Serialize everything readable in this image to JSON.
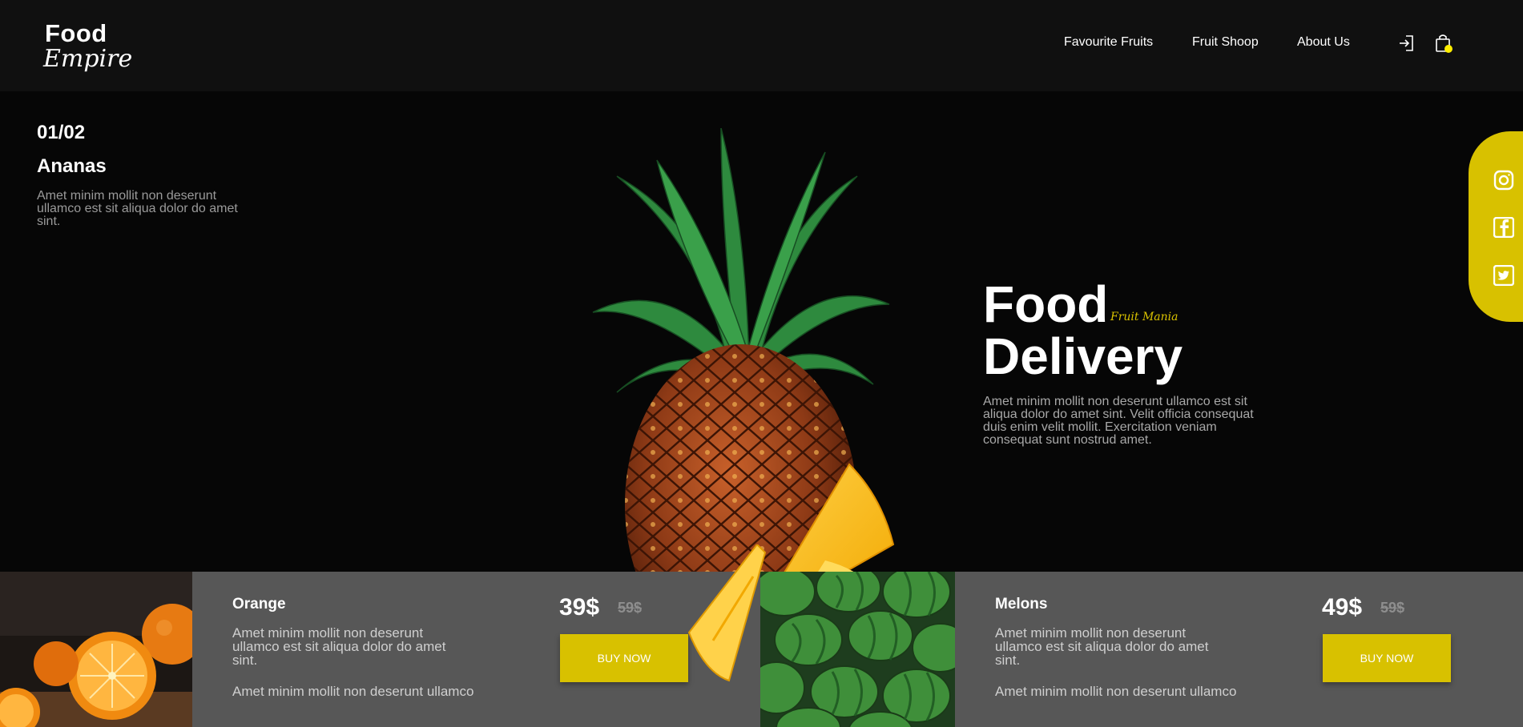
{
  "header": {
    "logo_line1": "Food",
    "logo_line2": "Empire",
    "nav": [
      "Favourite Fruits",
      "Fruit Shoop",
      "About Us"
    ],
    "icons": [
      "login-icon",
      "cart-icon"
    ],
    "cart_badge_color": "#ffee00"
  },
  "hero": {
    "counter": "01/02",
    "slide_title": "Ananas",
    "slide_desc": "Amet minim mollit non deserunt ullamco est sit aliqua dolor do amet sint.",
    "title_line1": "Food",
    "title_line2": "Delivery",
    "tagline": "Fruit Mania",
    "desc": "Amet minim mollit non deserunt ullamco est sit aliqua dolor do amet sint. Velit officia consequat duis enim velit mollit. Exercitation veniam consequat sunt nostrud amet.",
    "image": "pineapple"
  },
  "social": {
    "icons": [
      "instagram-icon",
      "facebook-icon",
      "twitter-icon"
    ]
  },
  "products": [
    {
      "image": "oranges",
      "name": "Orange",
      "desc": "Amet minim mollit non deserunt ullamco est sit aliqua dolor do amet sint.",
      "desc2": "Amet minim mollit non deserunt ullamco",
      "price": "39$",
      "old_price": "59$",
      "button": "BUY NOW"
    },
    {
      "image": "watermelons",
      "name": "Melons",
      "desc": "Amet minim mollit non deserunt ullamco est sit aliqua dolor do amet sint.",
      "desc2": "Amet minim mollit non deserunt ullamco",
      "price": "49$",
      "old_price": "59$",
      "button": "BUY NOW"
    }
  ],
  "colors": {
    "accent": "#d8c100",
    "header_bg": "#101010",
    "page_bg": "#060606",
    "band_bg": "#575757"
  }
}
